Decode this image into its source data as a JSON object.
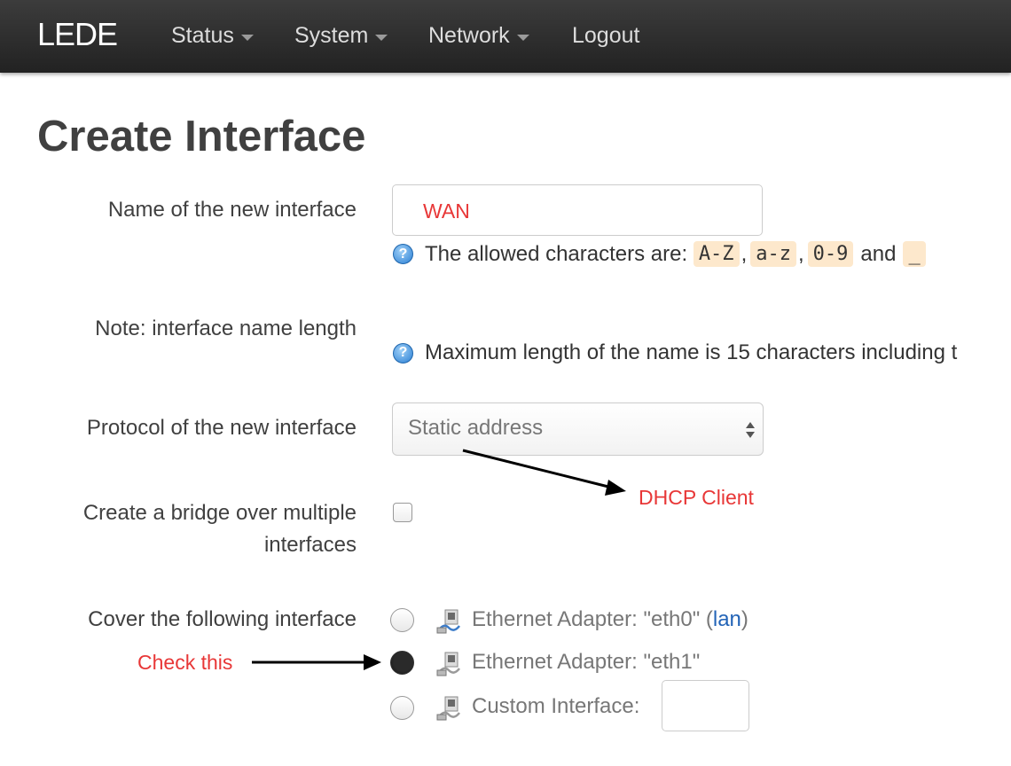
{
  "navbar": {
    "brand": "LEDE",
    "items": [
      {
        "label": "Status"
      },
      {
        "label": "System"
      },
      {
        "label": "Network"
      },
      {
        "label": "Logout"
      }
    ]
  },
  "page": {
    "title": "Create Interface"
  },
  "form": {
    "name": {
      "label": "Name of the new interface",
      "value": "WAN",
      "hint": {
        "prefix": "The allowed characters are: ",
        "codes": [
          "A-Z",
          "a-z",
          "0-9"
        ],
        "and": "and",
        "underscore": "_"
      }
    },
    "note": {
      "label": "Note: interface name length",
      "hint": "Maximum length of the name is 15 characters including t"
    },
    "protocol": {
      "label": "Protocol of the new interface",
      "selected": "Static address"
    },
    "bridge": {
      "label_line1": "Create a bridge over multiple",
      "label_line2": "interfaces",
      "checked": false
    },
    "cover": {
      "label": "Cover the following interface",
      "options": [
        {
          "text": "Ethernet Adapter: \"eth0\" (",
          "link": "lan",
          "close": ")",
          "checked": false
        },
        {
          "text": "Ethernet Adapter: \"eth1\"",
          "checked": true
        },
        {
          "text": "Custom Interface:",
          "checked": false
        }
      ]
    }
  },
  "annotations": {
    "dhcp": "DHCP Client",
    "check": "Check this",
    "color": "#e83737"
  },
  "icons": {
    "help": "help-icon",
    "adapter": "ethernet-adapter-icon"
  }
}
